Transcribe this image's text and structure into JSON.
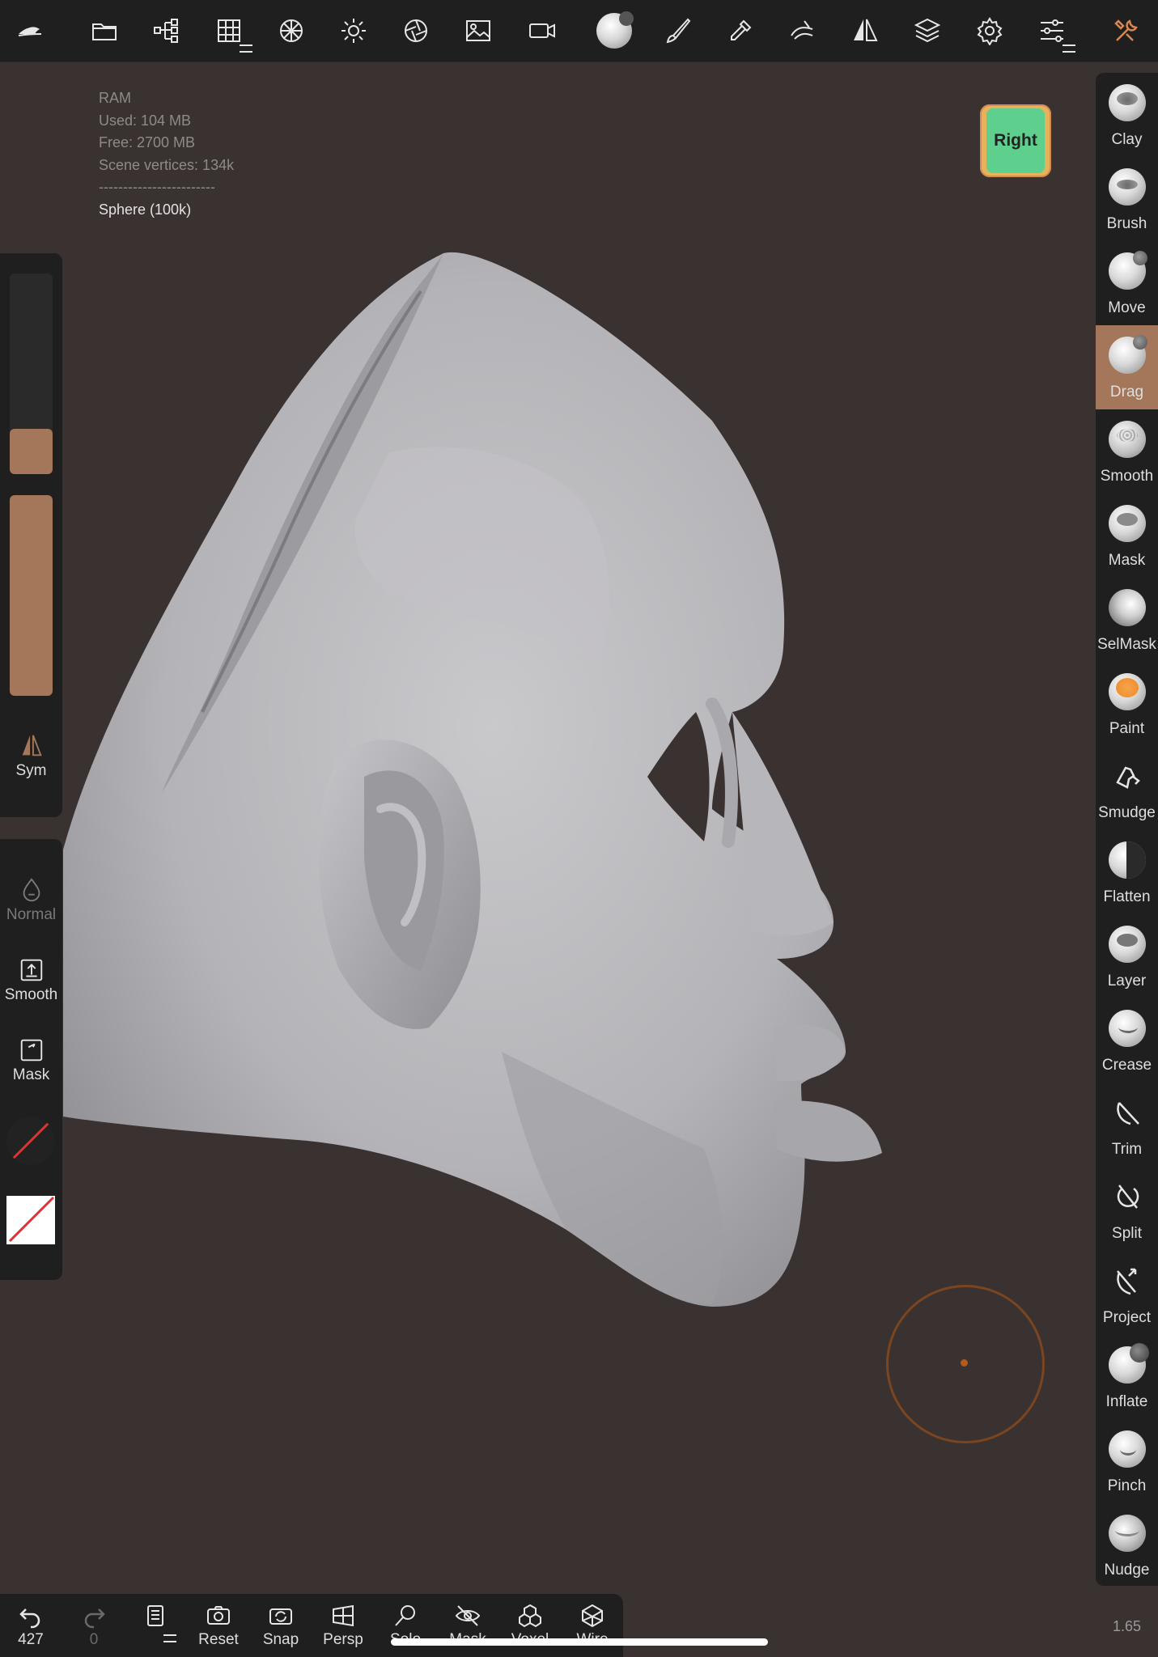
{
  "stats": {
    "title": "RAM",
    "used": "Used: 104 MB",
    "free": "Free: 2700 MB",
    "vertices": "Scene vertices: 134k",
    "separator": "------------------------",
    "object": "Sphere (100k)"
  },
  "view_cube": {
    "label": "Right"
  },
  "toolbar": {
    "icons": [
      "nomad-logo-icon",
      "folder-icon",
      "scene-tree-icon",
      "grid-icon",
      "topology-icon",
      "light-icon",
      "shading-icon",
      "image-icon",
      "camera-icon",
      "material-sphere-icon",
      "brush-icon",
      "eyedropper-icon",
      "stroke-icon",
      "symmetry-icon",
      "layers-icon",
      "settings-icon",
      "tools-settings-icon",
      "wrench-icon"
    ]
  },
  "tools": [
    {
      "label": "Clay"
    },
    {
      "label": "Brush"
    },
    {
      "label": "Move"
    },
    {
      "label": "Drag",
      "active": true
    },
    {
      "label": "Smooth"
    },
    {
      "label": "Mask"
    },
    {
      "label": "SelMask"
    },
    {
      "label": "Paint"
    },
    {
      "label": "Smudge"
    },
    {
      "label": "Flatten"
    },
    {
      "label": "Layer"
    },
    {
      "label": "Crease"
    },
    {
      "label": "Trim"
    },
    {
      "label": "Split"
    },
    {
      "label": "Project"
    },
    {
      "label": "Inflate"
    },
    {
      "label": "Pinch"
    },
    {
      "label": "Nudge"
    }
  ],
  "left_panel": {
    "sym": "Sym",
    "normal": "Normal",
    "smooth": "Smooth",
    "mask": "Mask",
    "radius_fraction": 0.22,
    "intensity_fraction": 1.0
  },
  "bottom_bar": {
    "undo_count": "427",
    "redo_count": "0",
    "reset": "Reset",
    "snap": "Snap",
    "persp": "Persp",
    "solo": "Solo",
    "mask": "Mask",
    "voxel": "Voxel",
    "wire": "Wire"
  },
  "zoom": "1.65",
  "colors": {
    "accent": "#a4775a",
    "panel": "#1f1f1f",
    "background": "#3a3230",
    "cube_face": "#5fcf8e",
    "brush_ring": "#7a4520"
  }
}
